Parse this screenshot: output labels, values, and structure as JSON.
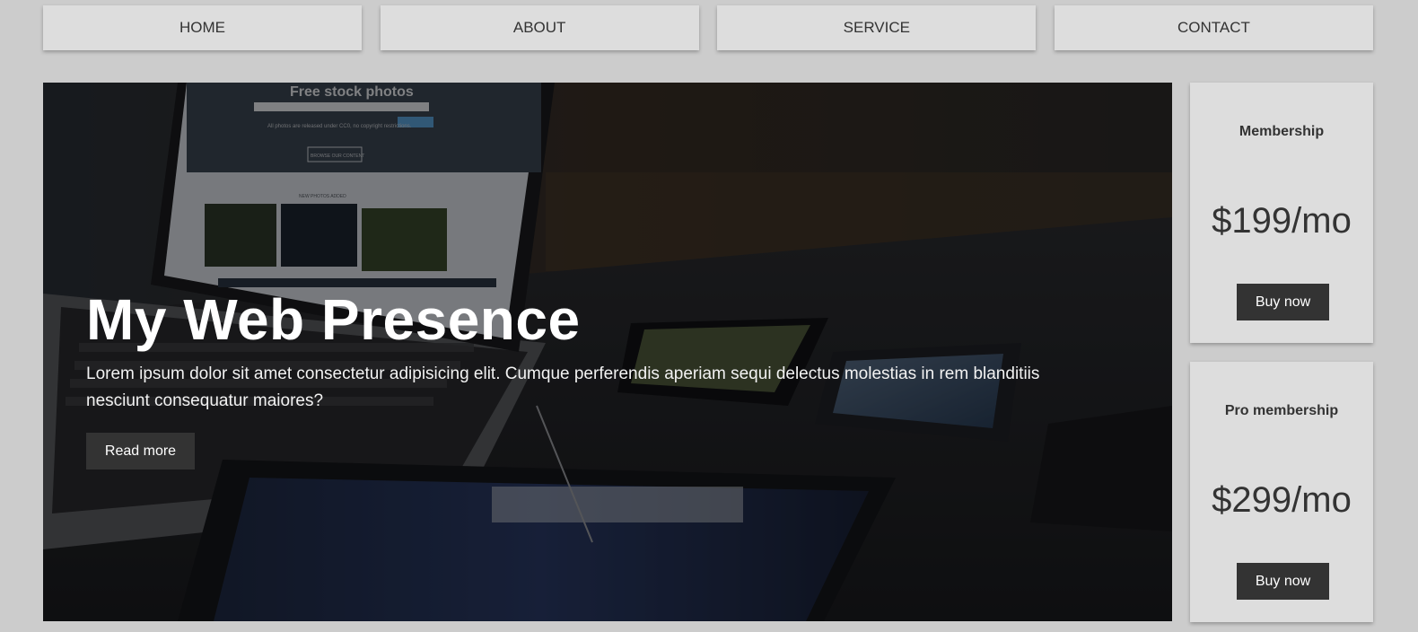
{
  "nav": {
    "items": [
      {
        "label": "HOME"
      },
      {
        "label": "ABOUT"
      },
      {
        "label": "SERVICE"
      },
      {
        "label": "CONTACT"
      }
    ]
  },
  "hero": {
    "title": "My Web Presence",
    "text": "Lorem ipsum dolor sit amet consectetur adipisicing elit. Cumque perferendis aperiam sequi delectus molestias in rem blanditiis nesciunt consequatur maiores?",
    "button_label": "Read more",
    "screen_headline": "Free stock photos",
    "screen_sub": "All photos are released under CC0, no copyright restrictions.",
    "screen_button": "BROWSE OUR CONTENT",
    "screen_section": "NEW PHOTOS ADDED"
  },
  "pricing": [
    {
      "title": "Membership",
      "price": "$199/mo",
      "button_label": "Buy now"
    },
    {
      "title": "Pro membership",
      "price": "$299/mo",
      "button_label": "Buy now"
    }
  ]
}
